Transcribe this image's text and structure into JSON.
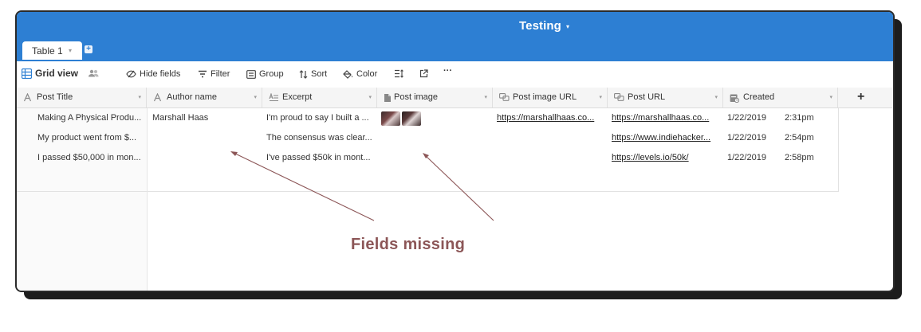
{
  "app": {
    "title": "Testing"
  },
  "tabs": [
    {
      "label": "Table 1"
    }
  ],
  "toolbar": {
    "view_name": "Grid view",
    "hide_fields": "Hide fields",
    "filter": "Filter",
    "group": "Group",
    "sort": "Sort",
    "color": "Color",
    "more": "···"
  },
  "columns": [
    {
      "label": "Post Title",
      "icon": "text-icon"
    },
    {
      "label": "Author name",
      "icon": "text-icon"
    },
    {
      "label": "Excerpt",
      "icon": "long-text-icon"
    },
    {
      "label": "Post image",
      "icon": "attachment-icon"
    },
    {
      "label": "Post image URL",
      "icon": "url-icon"
    },
    {
      "label": "Post URL",
      "icon": "url-icon"
    },
    {
      "label": "Created",
      "icon": "created-time-icon"
    }
  ],
  "rows": [
    {
      "post_title": "Making A Physical Produ...",
      "author_name": "Marshall Haas",
      "excerpt": "I'm proud to say I built a ...",
      "post_image": 2,
      "post_image_url": "https://marshallhaas.co...",
      "post_url": "https://marshallhaas.co...",
      "created_date": "1/22/2019",
      "created_time": "2:31pm"
    },
    {
      "post_title": "My product went from $...",
      "author_name": "",
      "excerpt": "The consensus was clear...",
      "post_image": 0,
      "post_image_url": "",
      "post_url": "https://www.indiehacker...",
      "created_date": "1/22/2019",
      "created_time": "2:54pm"
    },
    {
      "post_title": "I passed $50,000 in mon...",
      "author_name": "",
      "excerpt": "I've passed $50k in mont...",
      "post_image": 0,
      "post_image_url": "",
      "post_url": "https://levels.io/50k/",
      "created_date": "1/22/2019",
      "created_time": "2:58pm"
    }
  ],
  "annotation": {
    "text": "Fields missing",
    "color": "#8c5657"
  },
  "colors": {
    "header": "#2d7fd3",
    "view_icon": "#2d7fd3"
  }
}
